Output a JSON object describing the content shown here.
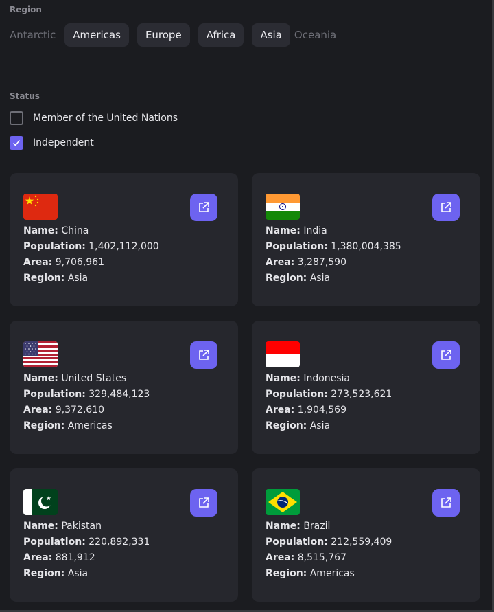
{
  "filters": {
    "region_label": "Region",
    "regions": [
      {
        "label": "Antarctic",
        "selected": false
      },
      {
        "label": "Americas",
        "selected": true
      },
      {
        "label": "Europe",
        "selected": true
      },
      {
        "label": "Africa",
        "selected": true
      },
      {
        "label": "Asia",
        "selected": true
      },
      {
        "label": "Oceania",
        "selected": false
      }
    ],
    "status_label": "Status",
    "status": [
      {
        "label": "Member of the United Nations",
        "checked": false
      },
      {
        "label": "Independent",
        "checked": true
      }
    ]
  },
  "field_labels": {
    "name": "Name:",
    "population": "Population:",
    "area": "Area:",
    "region": "Region:"
  },
  "countries": [
    {
      "name": "China",
      "population": "1,402,112,000",
      "area": "9,706,961",
      "region": "Asia",
      "flag": "china-flag-icon"
    },
    {
      "name": "India",
      "population": "1,380,004,385",
      "area": "3,287,590",
      "region": "Asia",
      "flag": "india-flag-icon"
    },
    {
      "name": "United States",
      "population": "329,484,123",
      "area": "9,372,610",
      "region": "Americas",
      "flag": "usa-flag-icon"
    },
    {
      "name": "Indonesia",
      "population": "273,523,621",
      "area": "1,904,569",
      "region": "Asia",
      "flag": "indonesia-flag-icon"
    },
    {
      "name": "Pakistan",
      "population": "220,892,331",
      "area": "881,912",
      "region": "Asia",
      "flag": "pakistan-flag-icon"
    },
    {
      "name": "Brazil",
      "population": "212,559,409",
      "area": "8,515,767",
      "region": "Americas",
      "flag": "brazil-flag-icon"
    }
  ],
  "colors": {
    "accent": "#6d63f0",
    "background": "#1b1c20",
    "card": "#26272d",
    "chip": "#2b2c33"
  }
}
